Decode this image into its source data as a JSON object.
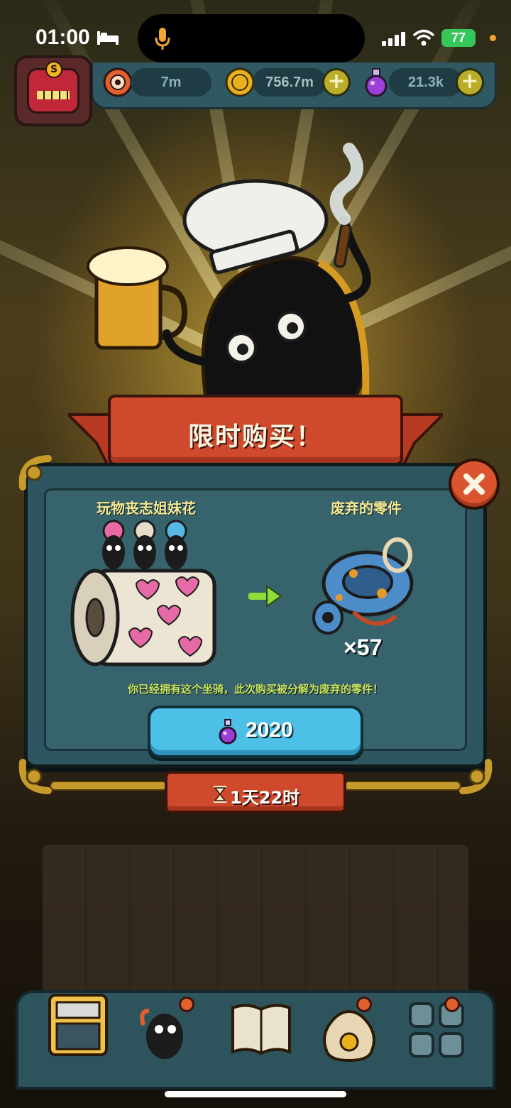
{
  "status_bar": {
    "time": "01:00",
    "battery": "77"
  },
  "resources": {
    "eyes": "7m",
    "coins": "756.7m",
    "potions": "21.3k",
    "avatar_badge": "S"
  },
  "offer": {
    "title": "限时购买！",
    "left_item_name": "玩物丧志姐妹花",
    "right_item_name": "废弃的零件",
    "right_item_count": "×57",
    "notice": "你已经拥有这个坐骑，此次购买被分解为废弃的零件！",
    "price": "2020",
    "timer": "1天22时"
  },
  "colors": {
    "modal_bg": "#2e5660",
    "banner_red": "#cf4a2c",
    "buy_button": "#4cc0e6",
    "notice_green": "#c8e35c",
    "item_name_yellow": "#f4ea95"
  },
  "icons": {
    "eye_currency": "eye-icon",
    "coin_currency": "coin-icon",
    "potion_currency": "potion-icon",
    "close": "close-icon",
    "arrow": "arrow-right-icon",
    "hourglass": "hourglass-icon"
  }
}
